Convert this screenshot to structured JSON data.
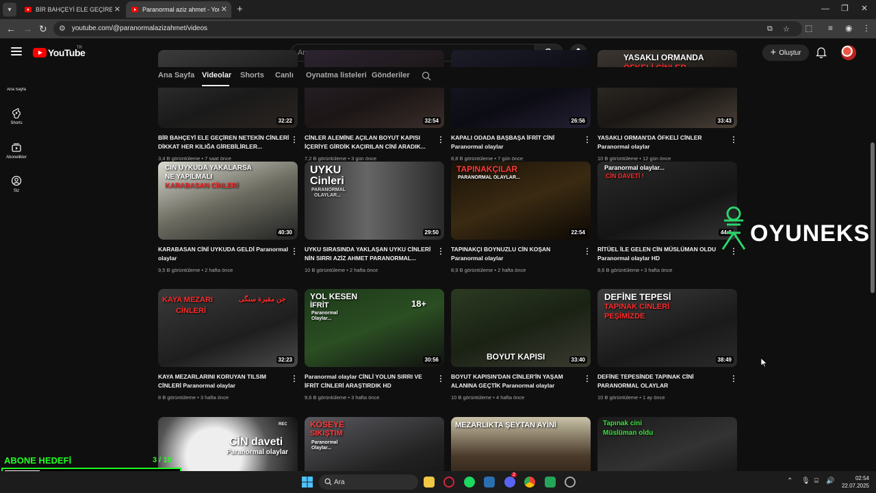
{
  "browser": {
    "tabs": [
      {
        "title": "BİR BAHÇEYİ ELE GEÇİREN NET",
        "active": false
      },
      {
        "title": "Paranormal aziz ahmet - YouTube",
        "active": true
      }
    ],
    "url": "youtube.com/@paranormalazizahmet/videos"
  },
  "header": {
    "logo_text": "YouTube",
    "country_code": "TR",
    "search_placeholder": "Ara",
    "create_label": "Oluştur"
  },
  "rail": [
    {
      "label": "Ana Sayfa",
      "icon": "home-icon"
    },
    {
      "label": "Shorts",
      "icon": "shorts-icon"
    },
    {
      "label": "Abonelikler",
      "icon": "subscriptions-icon"
    },
    {
      "label": "Siz",
      "icon": "you-icon"
    }
  ],
  "channel_tabs": [
    {
      "label": "Ana Sayfa",
      "active": false
    },
    {
      "label": "Videolar",
      "active": true
    },
    {
      "label": "Shorts",
      "active": false
    },
    {
      "label": "Canlı",
      "active": false
    },
    {
      "label": "Oynatma listeleri",
      "active": false
    },
    {
      "label": "Gönderiler",
      "active": false
    }
  ],
  "videos": [
    {
      "title": "BİR BAHÇEYİ ELE GEÇİREN NETEKİN CİNLERİ DİKKAT HER KILIĞA GİREBİLİRLER...",
      "meta": "3,4 B görüntüleme • 7 saat önce",
      "duration": "32:22",
      "overlay": []
    },
    {
      "title": "CİNLER ALEMİNE AÇILAN BOYUT KAPISI İÇERİYE GİRDİK KAÇIRILAN CİNİ ARADIK...",
      "meta": "7,2 B görüntüleme • 3 gün önce",
      "duration": "32:54",
      "overlay": []
    },
    {
      "title": "KAPALI ODADA BAŞBAŞA İFRİT CİNİ Paranormal olaylar",
      "meta": "8,8 B görüntüleme • 7 gün önce",
      "duration": "26:56",
      "overlay": []
    },
    {
      "title": "YASAKLI ORMAN'DA ÖFKELİ CİNLER Paranormal olaylar",
      "meta": "10 B görüntüleme • 12 gün önce",
      "duration": "33:43",
      "overlay": [
        "YASAKLI ORMANDA",
        "ÖFKELİ CİNLER"
      ]
    },
    {
      "title": "KARABASAN CİNİ UYKUDA GELDİ Paranormal olaylar",
      "meta": "9,5 B görüntüleme • 2 hafta önce",
      "duration": "40:30",
      "overlay": [
        "CİN UYKUDA YAKALARSA",
        "NE YAPILMALI",
        "KARABASAN CİNLERİ"
      ]
    },
    {
      "title": "UYKU SIRASINDA YAKLAŞAN UYKU CİNLERİ NİN SIRRI AZİZ AHMET PARANORMAL...",
      "meta": "10 B görüntüleme • 2 hafta önce",
      "duration": "29:50",
      "overlay": [
        "UYKU",
        "Cinleri",
        "PARANORMAL",
        "OLAYLAR..."
      ]
    },
    {
      "title": "TAPINAKÇI BOYNUZLU CİN KOŞAN Paranormal olaylar",
      "meta": "8,9 B görüntüleme • 2 hafta önce",
      "duration": "22:54",
      "overlay": [
        "TAPINAKÇILAR",
        "PARANORMAL OLAYLAR..."
      ]
    },
    {
      "title": "RİTÜEL İLE GELEN CİN MÜSLÜMAN OLDU Paranormal olaylar HD",
      "meta": "8,6 B görüntüleme • 3 hafta önce",
      "duration": "44:0",
      "overlay": [
        "Paranormal olaylar...",
        "CİN DAVETİ !"
      ]
    },
    {
      "title": "KAYA MEZARLARINI KORUYAN TILSIM CİNLERİ Paranormal olaylar",
      "meta": "8 B görüntüleme • 3 hafta önce",
      "duration": "32:23",
      "overlay": [
        "KAYA MEZARI",
        "CİNLERİ",
        "جن مقبرة سنگی"
      ]
    },
    {
      "title": "Paranormal olaylar CİNLİ YOLUN SIRRI VE İFRİT CİNLERİ ARAŞTIRDIK HD",
      "meta": "9,6 B görüntüleme • 3 hafta önce",
      "duration": "30:56",
      "overlay": [
        "YOL KESEN",
        "İFRİT",
        "Paranormal",
        "Olaylar...",
        "18+"
      ]
    },
    {
      "title": "BOYUT KAPISIN'DAN CİNLER'İN YAŞAM ALANINA GEÇTİK Paranormal olaylar",
      "meta": "10 B görüntüleme • 4 hafta önce",
      "duration": "33:40",
      "overlay": [
        "BOYUT KAPISI"
      ]
    },
    {
      "title": "DEFİNE TEPESİNDE TAPINAK CİNİ PARANORMAL OLAYLAR",
      "meta": "10 B görüntüleme • 1 ay önce",
      "duration": "38:49",
      "overlay": [
        "DEFİNE TEPESİ",
        "TAPINAK CİNLERİ",
        "PEŞİMİZDE"
      ]
    },
    {
      "title": "",
      "meta": "",
      "duration": "",
      "overlay": [
        "CİN daveti",
        "Paranormal olaylar",
        "REC"
      ]
    },
    {
      "title": "",
      "meta": "",
      "duration": "",
      "overlay": [
        "KÖSEYE",
        "SIKIŞTIM",
        "Paranormal",
        "Olaylar..."
      ]
    },
    {
      "title": "",
      "meta": "",
      "duration": "",
      "overlay": [
        "MEZARLIKTA ŞEYTAN AYİNİ"
      ]
    },
    {
      "title": "",
      "meta": "",
      "duration": "",
      "overlay": [
        "Tapınak cini",
        "Müslüman oldu"
      ]
    }
  ],
  "watermark": "OYUNEKS",
  "goal": {
    "label": "ABONE HEDEFİ",
    "count": "3 / 15",
    "progress": 0.2
  },
  "taskbar": {
    "search_placeholder": "Ara",
    "badge": "2",
    "time": "02:54",
    "date": "22.07.2025"
  },
  "colors": {
    "background": "#0f0f0f",
    "brand_red": "#ff0000",
    "goal_green": "#22ff22"
  }
}
